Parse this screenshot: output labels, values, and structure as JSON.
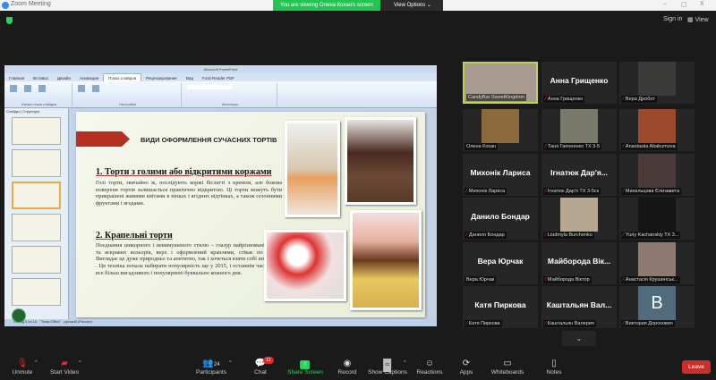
{
  "window": {
    "title": "Zoom Meeting",
    "banner": "You are viewing Олена Кохан's screen",
    "view_options": "View Options",
    "min": "–",
    "max": "▢",
    "close": "X"
  },
  "topbar": {
    "sign_in": "Sign in",
    "view": "View"
  },
  "ppt": {
    "title": "Microsoft PowerPoint",
    "tabs": [
      "Главная",
      "Вставка",
      "Дизайн",
      "Анимация",
      "Показ слайдов",
      "Рецензирование",
      "Вид",
      "Foxit Reader PDF"
    ],
    "groups": [
      "Начать показ слайдов",
      "Настройка",
      "Мониторы"
    ],
    "panel_tabs": [
      "Слайды",
      "Структура"
    ],
    "status": [
      "Слайд 5 из 16",
      "\"Тема Office\"",
      "русский (Россия)"
    ]
  },
  "slide": {
    "title": "ВИДИ ОФОРМЛЕННЯ СУЧАСНИХ ТОРТІВ",
    "h1": "1. Торти з голими або відкритими коржами",
    "p1": "Голі торти, звичайно ж, послідують коржі біслатті з кремом, але бокова поверхня тортів залишається практично відкритою. Ці торти можуть бути прикрашені живими квітами в вінках і ягідних відтінках, а також сезонними фруктами і ягодами.",
    "h2": "2. Крапельні торти",
    "p2": "Поєднання шикорного і невимушеного стилю – глазур найрізноманітніших та яскравих кольорів, верх і оформлений краплями, стікає по боках. Виглядає це дуже природньо та апетитно, так і хочеться взяти собі шматочок . Ця техніка почала набирати популярність ще у 2015, і останнім часом стає все більш вигадливою і популярною буквально кожного дня."
  },
  "gallery": [
    {
      "label": "CandyBar SweetKingdom",
      "video": "#a89a8e",
      "speaking": true,
      "muted": false
    },
    {
      "name": "Анна Грищенко",
      "label": "Анна Грищенко",
      "muted": true
    },
    {
      "label": "Вера Дробот",
      "video": "#3a3a38",
      "muted": true
    },
    {
      "label": "Олена Кохан",
      "video": "#8a6a3a",
      "muted": false
    },
    {
      "label": "Таня Гапоненко ТХ 3-5",
      "video": "#7a7a6a",
      "muted": true
    },
    {
      "label": "Anastasiia Abakumova",
      "video": "#9a4a2a",
      "muted": true
    },
    {
      "name": "Михонік Лариса",
      "label": "Михонік Лариса",
      "muted": true
    },
    {
      "name": "Ігнатюк Дар'я...",
      "label": "Ігнатюк Дар'я ТХ 3-5ск",
      "muted": true
    },
    {
      "label": "Михальцова Єлизавета",
      "video": "#4a3a3a",
      "muted": true
    },
    {
      "name": "Данило Бондар",
      "label": "Данило Бондар",
      "muted": true
    },
    {
      "label": "Liudmyla Burchenko",
      "video": "#b6a890",
      "muted": true
    },
    {
      "label": "Yuriy Kachanskiy TX 3...",
      "video": "#151515",
      "muted": true
    },
    {
      "name": "Вера Юрчак",
      "label": "Вера Юрчак",
      "muted": false
    },
    {
      "name": "Майборода Вік...",
      "label": "Майборода Віктор",
      "muted": true
    },
    {
      "label": "Анастасія Крушинськ...",
      "video": "#8e7a70",
      "muted": true
    },
    {
      "name": "Катя Пиркова",
      "label": "Катя Пиркова",
      "muted": true
    },
    {
      "name": "Каштальян Вал...",
      "label": "Каштальян Валерия",
      "muted": true
    },
    {
      "label": "Виктория Дорохович",
      "avatar": "B",
      "avatar_color": "#4f6b7c",
      "muted": true
    }
  ],
  "more": "⌄",
  "toolbar": {
    "unmute": "Unmute",
    "start_video": "Start Video",
    "participants": "Participants",
    "participants_count": "24",
    "chat": "Chat",
    "chat_badge": "11",
    "share": "Share Screen",
    "record": "Record",
    "captions": "Show Captions",
    "reactions": "Reactions",
    "apps": "Apps",
    "whiteboards": "Whiteboards",
    "notes": "Notes",
    "leave": "Leave"
  },
  "colors": {
    "share": "#23d959",
    "leave": "#c9302c",
    "speaker": "#b7d84a",
    "muted": "#e02a2a"
  }
}
